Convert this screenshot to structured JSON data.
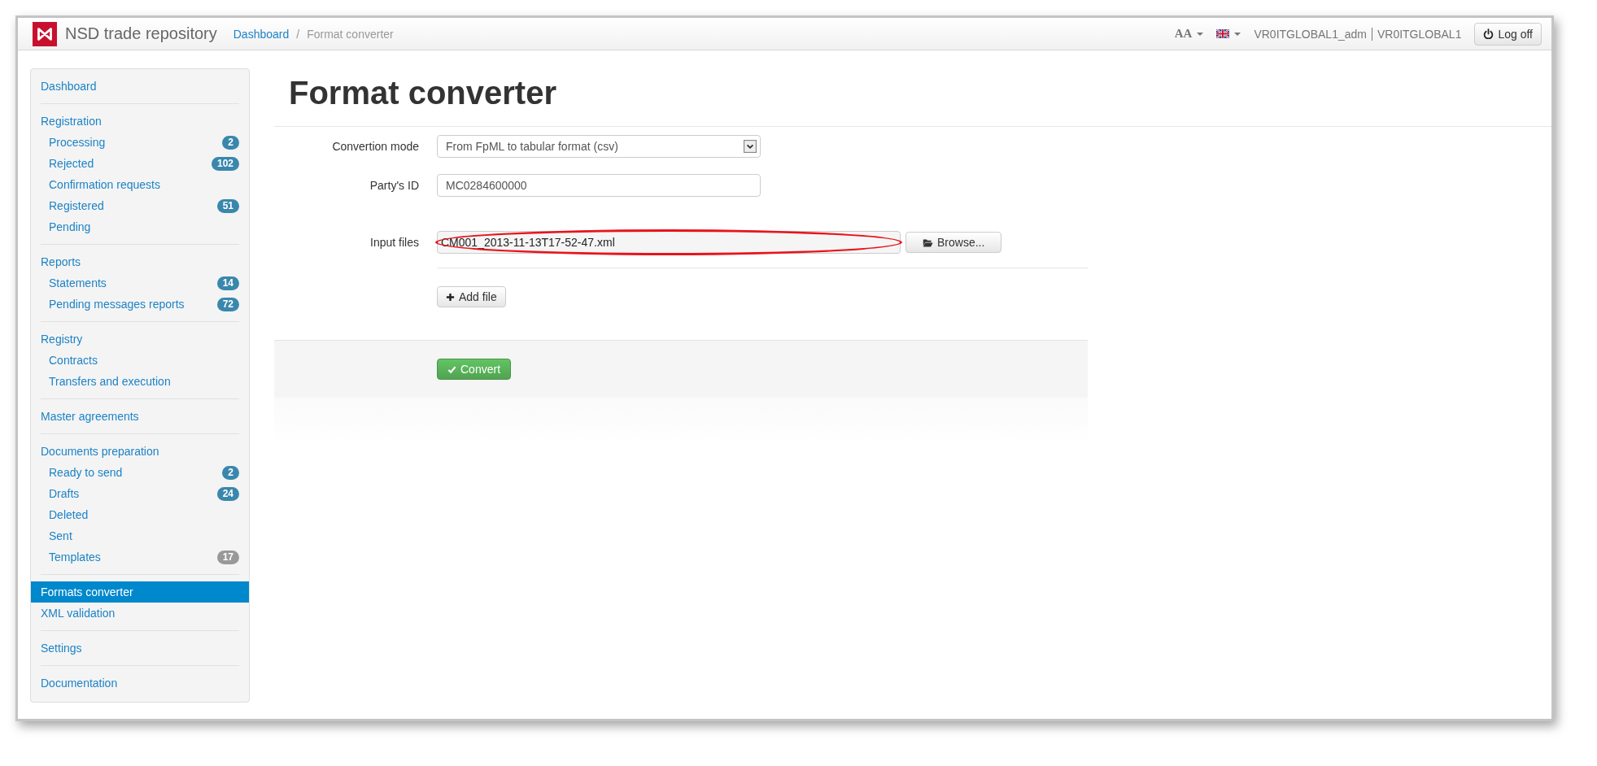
{
  "header": {
    "app_title": "NSD trade repository",
    "breadcrumb_separator": "/",
    "breadcrumb": [
      {
        "label": "Dashboard",
        "kind": "link"
      },
      {
        "label": "Format converter",
        "kind": "current"
      }
    ],
    "font_size_control": "AA",
    "user": "VR0ITGLOBAL1_adm",
    "account": "VR0ITGLOBAL1",
    "logoff": "Log off"
  },
  "sidebar": {
    "sections": [
      {
        "items": [
          {
            "label": "Dashboard",
            "selected": false
          }
        ]
      },
      {
        "items": [
          {
            "label": "Registration",
            "selected": false,
            "children": [
              {
                "label": "Processing",
                "selected": false,
                "badge": "2",
                "color": "#3a87ad"
              },
              {
                "label": "Rejected",
                "selected": false,
                "badge": "102",
                "color": "#3a87ad"
              },
              {
                "label": "Confirmation requests",
                "selected": false
              },
              {
                "label": "Registered",
                "selected": false,
                "badge": "51",
                "color": "#3a87ad"
              },
              {
                "label": "Pending",
                "selected": false
              }
            ]
          }
        ]
      },
      {
        "items": [
          {
            "label": "Reports",
            "selected": false,
            "children": [
              {
                "label": "Statements",
                "selected": false,
                "badge": "14",
                "color": "#3a87ad"
              },
              {
                "label": "Pending messages reports",
                "selected": false,
                "badge": "72",
                "color": "#3a87ad"
              }
            ]
          }
        ]
      },
      {
        "items": [
          {
            "label": "Registry",
            "selected": false,
            "children": [
              {
                "label": "Contracts",
                "selected": false
              },
              {
                "label": "Transfers and execution",
                "selected": false
              }
            ]
          }
        ]
      },
      {
        "items": [
          {
            "label": "Master agreements",
            "selected": false
          }
        ]
      },
      {
        "items": [
          {
            "label": "Documents preparation",
            "selected": false,
            "children": [
              {
                "label": "Ready to send",
                "selected": false,
                "badge": "2",
                "color": "#3a87ad"
              },
              {
                "label": "Drafts",
                "selected": false,
                "badge": "24",
                "color": "#3a87ad"
              },
              {
                "label": "Deleted",
                "selected": false
              },
              {
                "label": "Sent",
                "selected": false
              },
              {
                "label": "Templates",
                "selected": false,
                "badge": "17",
                "color": "#999999"
              }
            ]
          }
        ]
      },
      {
        "items": [
          {
            "label": "Formats converter",
            "selected": true
          },
          {
            "label": "XML validation",
            "selected": false
          }
        ]
      },
      {
        "items": [
          {
            "label": "Settings",
            "selected": false
          }
        ]
      },
      {
        "items": [
          {
            "label": "Documentation",
            "selected": false
          }
        ]
      }
    ]
  },
  "page_title": "Format converter",
  "form": {
    "conversion_mode": {
      "label": "Convertion mode",
      "value": "From FpML to tabular format (csv)"
    },
    "party_id": {
      "label": "Party's ID",
      "value": "MC0284600000"
    },
    "input_files": {
      "label": "Input files",
      "files": [
        "CM001_2013-11-13T17-52-47.xml"
      ],
      "browse": "Browse...",
      "add": "Add file"
    },
    "submit": "Convert"
  }
}
